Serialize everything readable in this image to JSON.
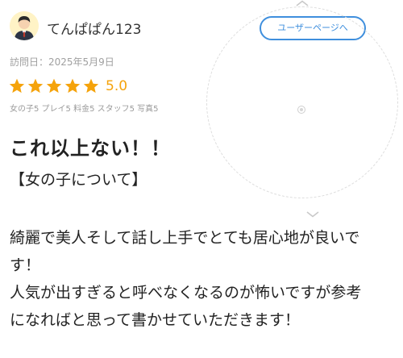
{
  "header": {
    "avatar_icon": "male-user-avatar-icon",
    "username": "てんぱぱん123",
    "user_page_button": "ユーザーページへ"
  },
  "review": {
    "visit_date": "訪問日：2025年5月9日",
    "rating": {
      "stars": 5,
      "max_stars": 5,
      "value": "5.0",
      "star_color": "#f5a30b"
    },
    "subratings": "女の子5 プレイ5 料金5 スタッフ5 写真5",
    "title": "これ以上ない！！",
    "section_heading": "【女の子について】",
    "body_lines": [
      "綺麗で美人そして話し上手でとても居心地が良いで",
      "す！",
      "人気が出すぎると呼べなくなるのが怖いですが参考",
      "になればと思って書かせていただきます！"
    ]
  },
  "overlay": {
    "loader_icon": "circular-zoom-loader-icon",
    "chevron_up_icon": "chevron-up-icon",
    "chevron_down_icon": "chevron-down-icon"
  },
  "colors": {
    "accent": "#3f8fdd",
    "star": "#f5a30b",
    "muted_text": "#a0a0a0"
  }
}
